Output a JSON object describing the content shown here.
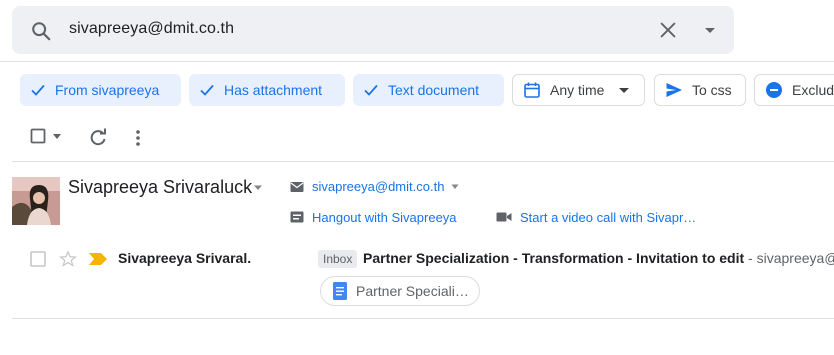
{
  "search": {
    "query": "sivapreeya@dmit.co.th"
  },
  "chips": [
    {
      "label": "From sivapreeya",
      "selected": true
    },
    {
      "label": "Has attachment",
      "selected": true
    },
    {
      "label": "Text document",
      "selected": true
    },
    {
      "label": "Any time",
      "selected": false
    },
    {
      "label": "To css",
      "selected": false
    },
    {
      "label": "Exclud",
      "selected": false
    }
  ],
  "contact": {
    "name": "Sivapreeya Srivaraluck",
    "email": "sivapreeya@dmit.co.th",
    "hangout": "Hangout with Sivapreeya",
    "video_call": "Start a video call with Sivapr…"
  },
  "message": {
    "sender": "Sivapreeya Srivaral.",
    "label": "Inbox",
    "subject": "Partner Specialization - Transformation - Invitation to edit",
    "snippet": " - sivapreeya@d",
    "attachment": "Partner Speciali…"
  },
  "colors": {
    "accent": "#1a73e8",
    "chip_bg": "#e8f0fe",
    "important": "#f4b400"
  }
}
